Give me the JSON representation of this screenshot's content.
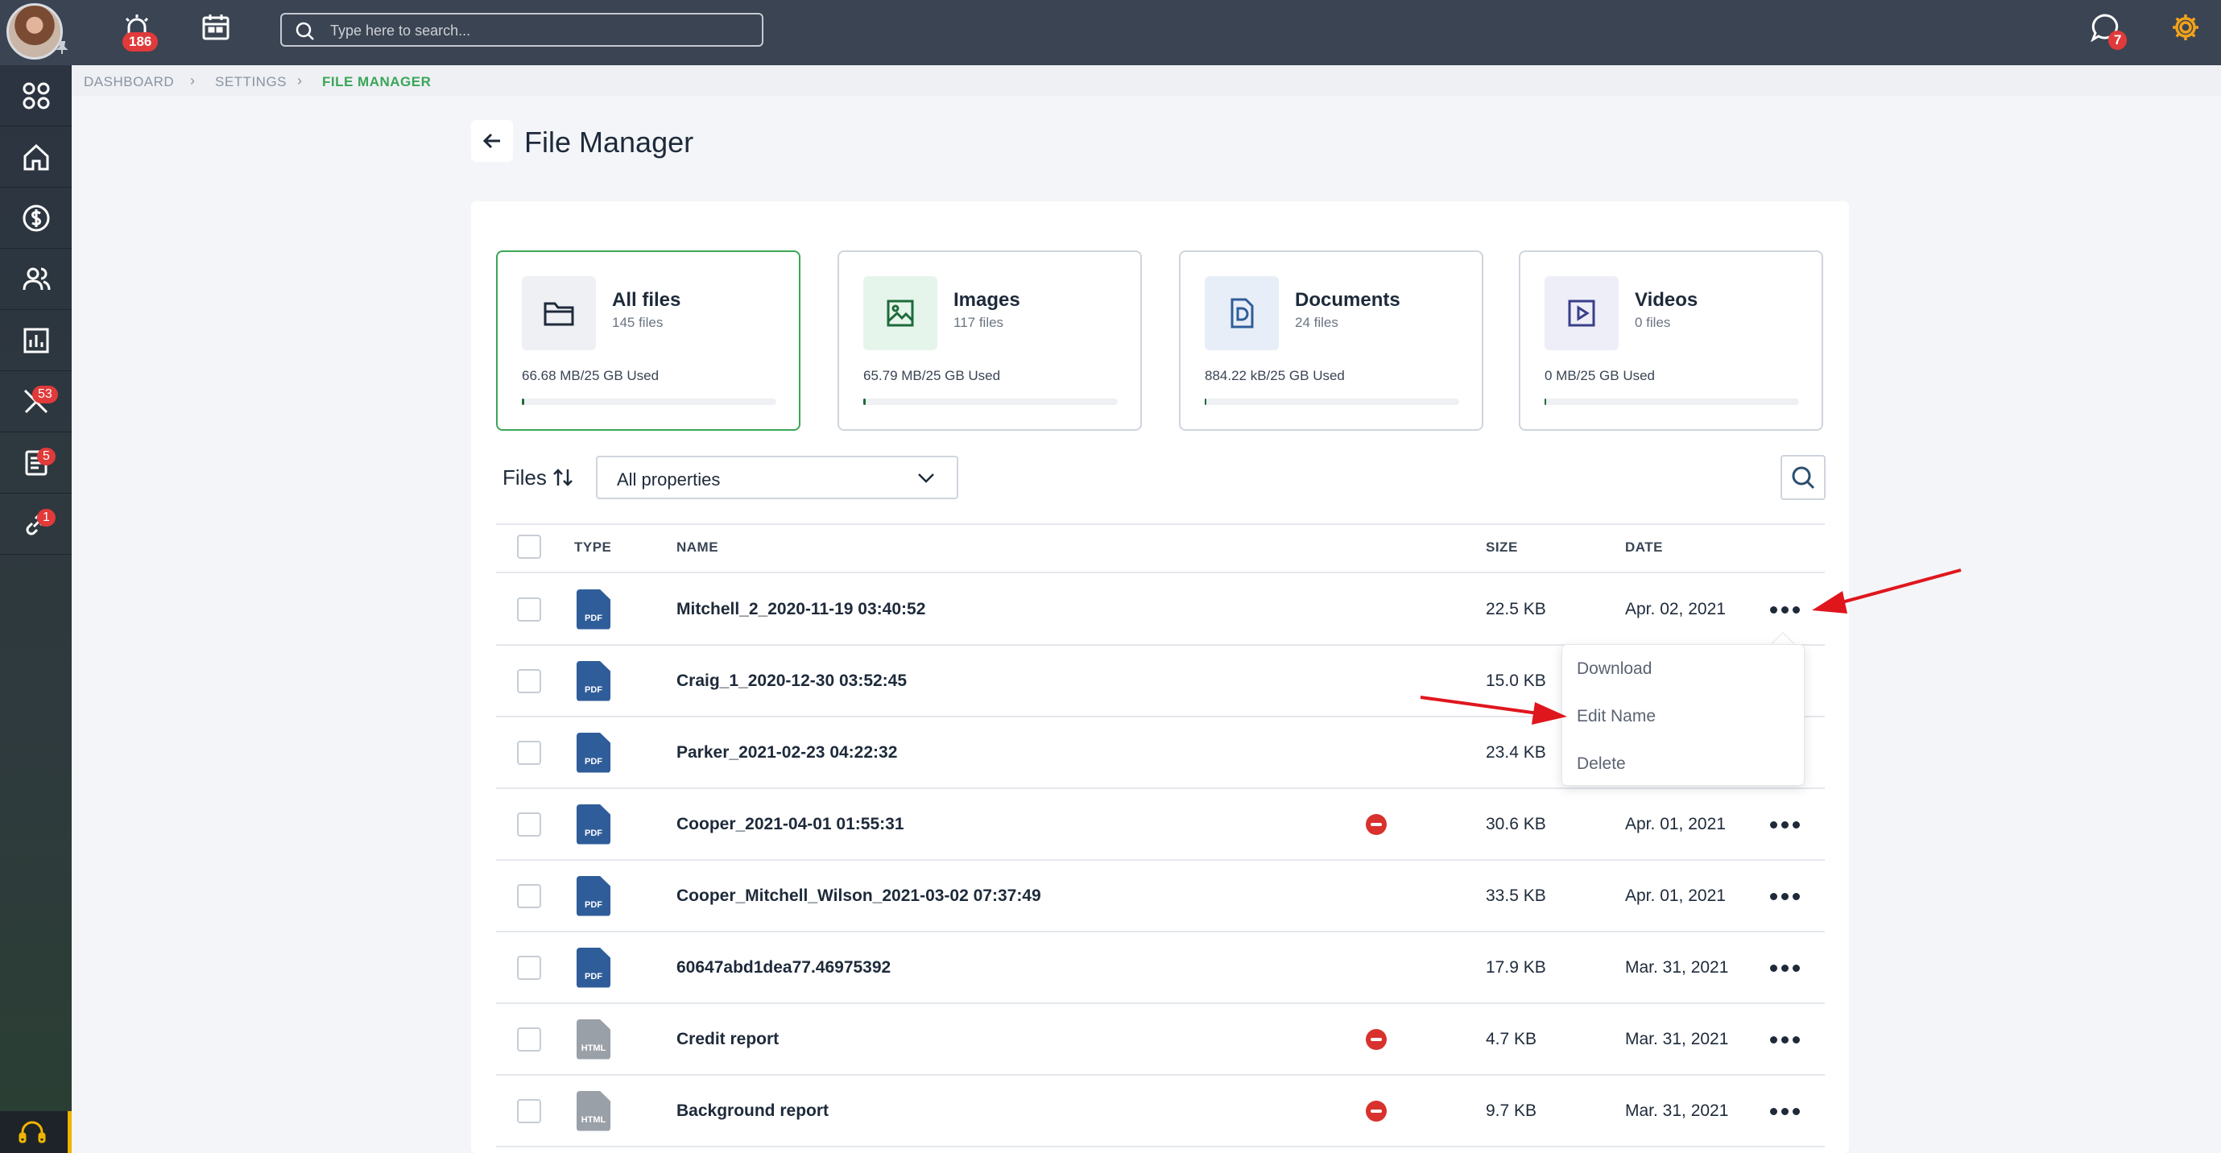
{
  "topbar": {
    "alerts_count": "186",
    "search_placeholder": "Type here to search...",
    "messages_count": "7"
  },
  "sidebar": {
    "badges": {
      "tools": "53",
      "docs": "5",
      "links": "1"
    }
  },
  "breadcrumb": [
    "DASHBOARD",
    "SETTINGS",
    "FILE MANAGER"
  ],
  "page": {
    "title": "File Manager"
  },
  "stats": [
    {
      "title": "All files",
      "count": "145 files",
      "used": "66.68 MB/25 GB Used",
      "usage_fraction": 0.003,
      "icon": "folder-icon"
    },
    {
      "title": "Images",
      "count": "117 files",
      "used": "65.79 MB/25 GB Used",
      "usage_fraction": 0.003,
      "icon": "image-icon"
    },
    {
      "title": "Documents",
      "count": "24 files",
      "used": "884.22 kB/25 GB Used",
      "usage_fraction": 0.0,
      "icon": "document-icon"
    },
    {
      "title": "Videos",
      "count": "0 files",
      "used": "0 MB/25 GB Used",
      "usage_fraction": 0.0,
      "icon": "video-icon"
    }
  ],
  "filter": {
    "label": "Files",
    "select_value": "All properties"
  },
  "table": {
    "headers": {
      "type": "TYPE",
      "name": "NAME",
      "size": "SIZE",
      "date": "DATE"
    },
    "rows": [
      {
        "type": "PDF",
        "name": "Mitchell_2_2020-11-19 03:40:52",
        "size": "22.5 KB",
        "date": "Apr. 02, 2021",
        "flag": false
      },
      {
        "type": "PDF",
        "name": "Craig_1_2020-12-30 03:52:45",
        "size": "15.0 KB",
        "date": "",
        "flag": false
      },
      {
        "type": "PDF",
        "name": "Parker_2021-02-23 04:22:32",
        "size": "23.4 KB",
        "date": "",
        "flag": false
      },
      {
        "type": "PDF",
        "name": "Cooper_2021-04-01 01:55:31",
        "size": "30.6 KB",
        "date": "Apr. 01, 2021",
        "flag": true
      },
      {
        "type": "PDF",
        "name": "Cooper_Mitchell_Wilson_2021-03-02 07:37:49",
        "size": "33.5 KB",
        "date": "Apr. 01, 2021",
        "flag": false
      },
      {
        "type": "PDF",
        "name": "60647abd1dea77.46975392",
        "size": "17.9 KB",
        "date": "Mar. 31, 2021",
        "flag": false
      },
      {
        "type": "HTML",
        "name": "Credit report",
        "size": "4.7 KB",
        "date": "Mar. 31, 2021",
        "flag": true
      },
      {
        "type": "HTML",
        "name": "Background report",
        "size": "9.7 KB",
        "date": "Mar. 31, 2021",
        "flag": true
      }
    ]
  },
  "row_menu": {
    "items": [
      "Download",
      "Edit Name",
      "Delete"
    ]
  },
  "colors": {
    "accent_green": "#3aa657",
    "topbar": "#3b4452",
    "pdf_blue": "#2f5d9a",
    "html_gray": "#9aa0a8",
    "annotation_red": "#e0161d"
  }
}
